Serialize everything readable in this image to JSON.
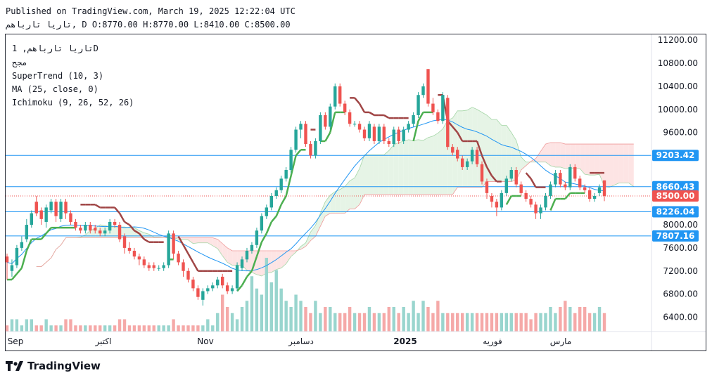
{
  "header": {
    "published": "Published on TradingView.com, March 19, 2025 12:22:04 UTC",
    "symbol_line": "تاريا تارباهم, D O:8770.00 H:8770.00 L:8410.00 C:8500.00"
  },
  "legend": {
    "symbol": "تاريا تارباهم, 1D",
    "exchange": "مجح",
    "supertrend": "SuperTrend (10, 3)",
    "ma": "MA (25, close, 0)",
    "ichimoku": "Ichimoku (9, 26, 52, 26)"
  },
  "brand": {
    "name": "TradingView",
    "logo_icon": "tradingview-logo-icon"
  },
  "colors": {
    "up": "#26a69a",
    "down": "#ef5350",
    "supertrend_up": "#4caf50",
    "supertrend_down": "#a04545",
    "ma": "#2196f3",
    "hline": "#2196f3",
    "cloud_green": "#e6f4e6",
    "cloud_red": "#fde4e4"
  },
  "chart_data": {
    "type": "candlestick",
    "y_axis_ticks": [
      "11200.00",
      "10800.00",
      "10400.00",
      "10000.00",
      "9600.00",
      "8000.00",
      "7600.00",
      "7200.00",
      "6800.00",
      "6400.00"
    ],
    "ylim": [
      6150,
      11300
    ],
    "x_labels": [
      "Sep",
      "اكتبر",
      "Nov",
      "دسامبر",
      "2025",
      "فوريه",
      "مارس"
    ],
    "price_labels": [
      {
        "text": "9203.42",
        "value": 9203.42,
        "color": "#2196f3"
      },
      {
        "text": "8660.43",
        "value": 8660.43,
        "color": "#2196f3"
      },
      {
        "text": "8500.00",
        "value": 8500,
        "color": "#ef5350"
      },
      {
        "text": "8226.04",
        "value": 8226.04,
        "color": "#2196f3"
      },
      {
        "text": "7807.16",
        "value": 7807.16,
        "color": "#2196f3"
      }
    ],
    "horizontal_lines": [
      9203.42,
      8660.43,
      8226.04,
      7807.16
    ],
    "last_close": 8500,
    "candles": [
      [
        7450,
        7350,
        7500,
        7050
      ],
      [
        7200,
        7300,
        7400,
        7100
      ],
      [
        7300,
        7600,
        7650,
        7250
      ],
      [
        7600,
        7700,
        7800,
        7550
      ],
      [
        7750,
        8000,
        8100,
        7700
      ],
      [
        8000,
        8200,
        8250,
        7950
      ],
      [
        8400,
        8200,
        8500,
        8150
      ],
      [
        8250,
        8100,
        8300,
        8000
      ],
      [
        8050,
        8300,
        8350,
        7950
      ],
      [
        8250,
        8400,
        8450,
        8200
      ],
      [
        8400,
        8150,
        8450,
        8050
      ],
      [
        8100,
        8400,
        8450,
        8050
      ],
      [
        8400,
        8200,
        8450,
        8100
      ],
      [
        8200,
        8050,
        8250,
        8000
      ],
      [
        8050,
        7950,
        8100,
        7900
      ],
      [
        7950,
        7900,
        8000,
        7850
      ],
      [
        7900,
        8000,
        8050,
        7850
      ],
      [
        8000,
        7900,
        8050,
        7850
      ],
      [
        7950,
        7900,
        8000,
        7850
      ],
      [
        7900,
        7850,
        7950,
        7800
      ],
      [
        7850,
        7900,
        7950,
        7800
      ],
      [
        7900,
        8050,
        8100,
        7850
      ],
      [
        8050,
        8000,
        8100,
        7950
      ],
      [
        8000,
        7750,
        8050,
        7700
      ],
      [
        7800,
        7600,
        7850,
        7500
      ],
      [
        7600,
        7550,
        7700,
        7500
      ],
      [
        7550,
        7450,
        7600,
        7400
      ],
      [
        7450,
        7400,
        7500,
        7300
      ],
      [
        7400,
        7300,
        7450,
        7250
      ],
      [
        7300,
        7250,
        7350,
        7200
      ],
      [
        7300,
        7250,
        7350,
        7200
      ],
      [
        7250,
        7250,
        7300,
        7200
      ],
      [
        7250,
        7300,
        7350,
        7200
      ],
      [
        7300,
        7850,
        7900,
        7250
      ],
      [
        7850,
        7500,
        7900,
        7400
      ],
      [
        7500,
        7350,
        7550,
        7300
      ],
      [
        7350,
        7200,
        7400,
        7100
      ],
      [
        7200,
        7050,
        7250,
        7000
      ],
      [
        7050,
        6900,
        7100,
        6850
      ],
      [
        6900,
        6750,
        6950,
        6700
      ],
      [
        6700,
        6850,
        6900,
        6600
      ],
      [
        6850,
        6900,
        6950,
        6800
      ],
      [
        6900,
        6950,
        7000,
        6850
      ],
      [
        6950,
        7050,
        7100,
        6900
      ],
      [
        7100,
        6950,
        7150,
        6900
      ],
      [
        6950,
        6850,
        7000,
        6800
      ],
      [
        6850,
        6900,
        6950,
        6800
      ],
      [
        6900,
        7300,
        7350,
        6850
      ],
      [
        7250,
        7400,
        7450,
        7200
      ],
      [
        7400,
        7550,
        7600,
        7350
      ],
      [
        7550,
        7650,
        7700,
        7500
      ],
      [
        7650,
        7900,
        7950,
        7600
      ],
      [
        7900,
        8150,
        8200,
        7850
      ],
      [
        8150,
        8300,
        8350,
        8100
      ],
      [
        8300,
        8500,
        8550,
        8250
      ],
      [
        8500,
        8600,
        8650,
        8450
      ],
      [
        8600,
        8800,
        8850,
        8550
      ],
      [
        8800,
        8950,
        9000,
        8750
      ],
      [
        8950,
        9300,
        9350,
        8900
      ],
      [
        9300,
        9650,
        9700,
        9250
      ],
      [
        9650,
        9750,
        9800,
        9500
      ],
      [
        9750,
        9400,
        9800,
        9350
      ],
      [
        9400,
        9200,
        9450,
        9150
      ],
      [
        9200,
        9450,
        9500,
        9150
      ],
      [
        9450,
        9900,
        9950,
        9400
      ],
      [
        9900,
        9700,
        9950,
        9650
      ],
      [
        9700,
        10050,
        10100,
        9650
      ],
      [
        10050,
        10400,
        10450,
        10000
      ],
      [
        10400,
        10100,
        10450,
        10050
      ],
      [
        10100,
        9950,
        10150,
        9900
      ],
      [
        9950,
        9750,
        10000,
        9700
      ],
      [
        9750,
        9750,
        9800,
        9700
      ],
      [
        9750,
        9650,
        9800,
        9600
      ],
      [
        9650,
        9500,
        9700,
        9450
      ],
      [
        9500,
        9750,
        9800,
        9450
      ],
      [
        9700,
        9450,
        9750,
        9400
      ],
      [
        9450,
        9700,
        9750,
        9400
      ],
      [
        9700,
        9450,
        9750,
        9400
      ],
      [
        9450,
        9400,
        9500,
        9350
      ],
      [
        9400,
        9650,
        9700,
        9350
      ],
      [
        9650,
        9450,
        9700,
        9400
      ],
      [
        9450,
        9650,
        9700,
        9400
      ],
      [
        9650,
        9750,
        9800,
        9600
      ],
      [
        9750,
        9900,
        9950,
        9700
      ],
      [
        9900,
        10250,
        10300,
        9850
      ],
      [
        10250,
        10400,
        10450,
        10200
      ],
      [
        10700,
        10100,
        10700,
        10050
      ],
      [
        10100,
        9950,
        10200,
        9900
      ],
      [
        9950,
        9800,
        10000,
        9750
      ],
      [
        9800,
        10250,
        10300,
        9750
      ],
      [
        10200,
        9350,
        10250,
        9300
      ],
      [
        9350,
        9250,
        9400,
        9200
      ],
      [
        9300,
        9150,
        9350,
        9100
      ],
      [
        9150,
        9000,
        9200,
        8950
      ],
      [
        9000,
        9100,
        9150,
        8950
      ],
      [
        9100,
        9300,
        9350,
        9050
      ],
      [
        9300,
        9050,
        9350,
        9000
      ],
      [
        9050,
        8750,
        9100,
        8700
      ],
      [
        8750,
        8550,
        8800,
        8450
      ],
      [
        8500,
        8400,
        8550,
        8300
      ],
      [
        8400,
        8300,
        8450,
        8150
      ],
      [
        8300,
        8550,
        8600,
        8250
      ],
      [
        8550,
        8800,
        8850,
        8500
      ],
      [
        8800,
        8950,
        9000,
        8750
      ],
      [
        8950,
        8700,
        9000,
        8650
      ],
      [
        8700,
        8550,
        8750,
        8500
      ],
      [
        8550,
        8450,
        8600,
        8400
      ],
      [
        8450,
        8350,
        8500,
        8300
      ],
      [
        8350,
        8200,
        8400,
        8100
      ],
      [
        8200,
        8300,
        8350,
        8100
      ],
      [
        8300,
        8500,
        8550,
        8250
      ],
      [
        8500,
        8700,
        8750,
        8450
      ],
      [
        8700,
        8900,
        8950,
        8650
      ],
      [
        8900,
        8700,
        8950,
        8650
      ],
      [
        8700,
        8650,
        8750,
        8600
      ],
      [
        8650,
        9000,
        9050,
        8600
      ],
      [
        9000,
        8800,
        9050,
        8750
      ],
      [
        8800,
        8650,
        8850,
        8600
      ],
      [
        8650,
        8600,
        8700,
        8550
      ],
      [
        8600,
        8450,
        8650,
        8400
      ],
      [
        8450,
        8500,
        8550,
        8400
      ],
      [
        8550,
        8650,
        8700,
        8500
      ],
      [
        8770,
        8500,
        8770,
        8410
      ]
    ],
    "volume": [
      1,
      2,
      2,
      1,
      2,
      2,
      1,
      1,
      2,
      1,
      1,
      1,
      2,
      2,
      1,
      1,
      1,
      1,
      1,
      1,
      1,
      1,
      1,
      2,
      2,
      1,
      1,
      1,
      1,
      1,
      1,
      1,
      1,
      1,
      2,
      1,
      1,
      1,
      1,
      1,
      1,
      2,
      1,
      3,
      6,
      4,
      3,
      2,
      4,
      5,
      9,
      7,
      6,
      12,
      8,
      10,
      7,
      5,
      4,
      6,
      5,
      4,
      3,
      5,
      3,
      4,
      4,
      3,
      3,
      3,
      4,
      3,
      3,
      3,
      4,
      3,
      3,
      3,
      4,
      4,
      3,
      4,
      3,
      5,
      3,
      5,
      4,
      3,
      5,
      3,
      3,
      3,
      3,
      3,
      3,
      3,
      3,
      3,
      3,
      3,
      3,
      3,
      3,
      3,
      3,
      3,
      3,
      2,
      3,
      3,
      3,
      4,
      3,
      4,
      5,
      4,
      3,
      4,
      4,
      3,
      3,
      4,
      3
    ]
  }
}
